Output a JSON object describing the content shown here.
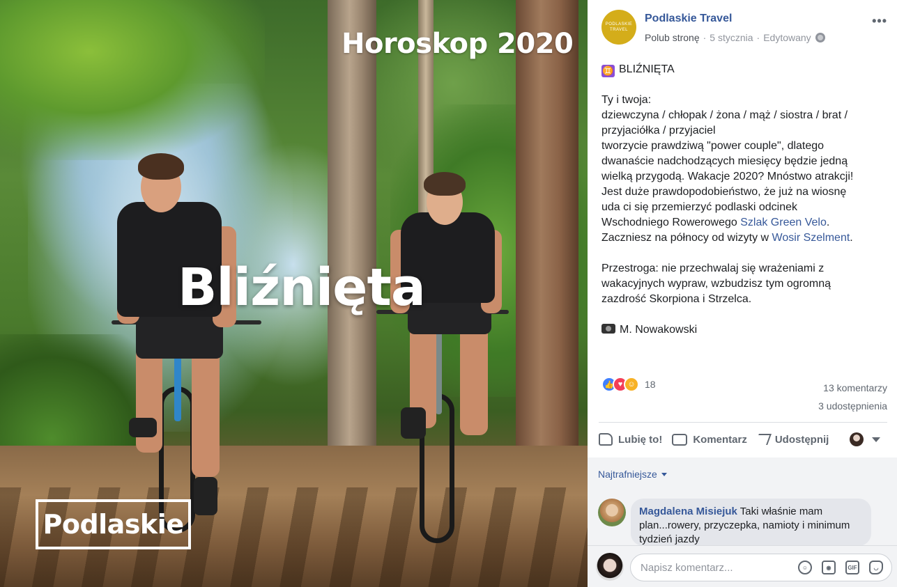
{
  "photo": {
    "headline": "Horoskop 2020",
    "sign": "Bliźnięta",
    "brand_logo": "Podlaskie"
  },
  "post": {
    "page_avatar_text": [
      "PODLASKIE",
      "TRAVEL"
    ],
    "page_name": "Podlaskie Travel",
    "like_page": "Polub stronę",
    "date": "5 stycznia",
    "edited": "Edytowany",
    "more": "•••",
    "sign_heading": "BLIŹNIĘTA",
    "para1_lines": [
      "Ty i twoja:",
      "dziewczyna / chłopak / żona / mąż / siostra / brat /",
      "przyjaciółka / przyjaciel",
      "tworzycie prawdziwą \"power couple\", dlatego",
      "dwanaście nadchodzących miesięcy będzie jedną",
      "wielką przygodą. Wakacje 2020? Mnóstwo atrakcji!",
      "Jest duże prawdopodobieństwo, że już na wiosnę",
      "uda ci się przemierzyć podlaski odcinek"
    ],
    "para1_line9_pre": "Wschodniego Rowerowego ",
    "link_green_velo": "Szlak Green Velo",
    "para1_line9_post": ".",
    "para1_line10_pre": "Zaczniesz na północy od wizyty w ",
    "link_wosir": "Wosir Szelment",
    "para1_line10_post": ".",
    "para2_lines": [
      "Przestroga: nie przechwalaj się wrażeniami z",
      "wakacyjnych wypraw, wzbudzisz tym ogromną",
      "zazdrość Skorpiona i Strzelca."
    ],
    "photo_credit": "M. Nowakowski"
  },
  "stats": {
    "reactions_count": "18",
    "comments": "13 komentarzy",
    "shares": "3 udostępnienia"
  },
  "actions": {
    "like": "Lubię to!",
    "comment": "Komentarz",
    "share": "Udostępnij"
  },
  "comments": {
    "sort_label": "Najtrafniejsze",
    "items": [
      {
        "author": "Magdalena Misiejuk",
        "text": "Taki właśnie mam plan...rowery, przyczepka, namioty i minimum tydzień jazdy"
      }
    ]
  },
  "composer": {
    "placeholder": "Napisz komentarz...",
    "gif_label": "GIF"
  },
  "colors": {
    "link": "#365899",
    "page_avatar_bg": "#d4ad1a",
    "sign_emoji_bg": "#8a4fd6"
  }
}
